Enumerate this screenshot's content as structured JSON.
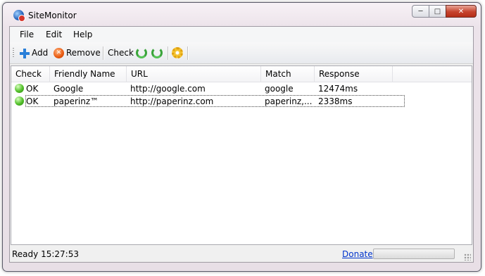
{
  "window": {
    "title": "SiteMonitor",
    "controls": {
      "minimize": "─",
      "maximize": "□",
      "close": "✕"
    }
  },
  "menu": [
    "File",
    "Edit",
    "Help"
  ],
  "toolbar": {
    "add_label": "Add",
    "remove_label": "Remove",
    "check_label": "Check"
  },
  "list": {
    "columns": [
      "Check",
      "Friendly Name",
      "URL",
      "Match",
      "Response"
    ],
    "rows": [
      {
        "status": "OK",
        "name": "Google",
        "url": "http://google.com",
        "match": "google",
        "response": "12474ms"
      },
      {
        "status": "OK",
        "name": "paperinz™",
        "url": "http://paperinz.com",
        "match": "paperinz,...",
        "response": "2338ms"
      }
    ]
  },
  "statusbar": {
    "text": "Ready 15:27:53",
    "donate_label": "Donate"
  },
  "colors": {
    "status_ok": "#52c02a",
    "link": "#0033cc",
    "close_button": "#c6432d"
  }
}
